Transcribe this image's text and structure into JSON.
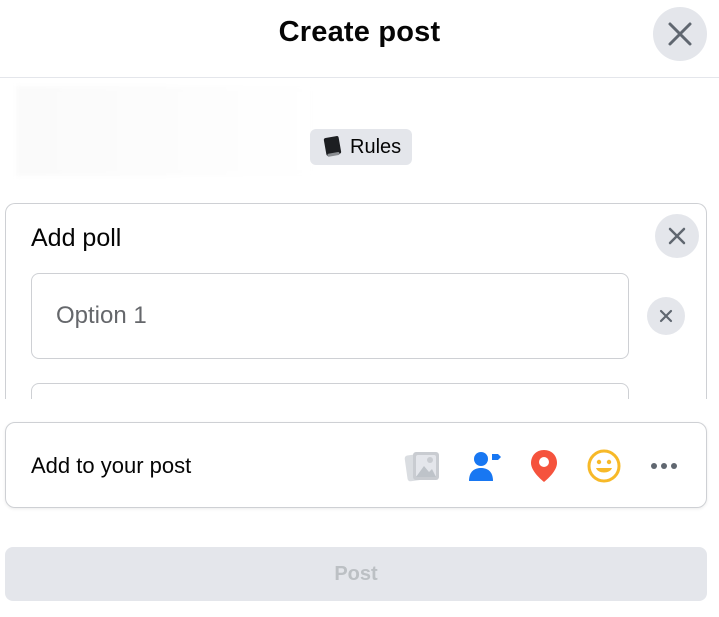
{
  "dialog": {
    "title": "Create post",
    "close_icon": "close-icon"
  },
  "rules": {
    "label": "Rules",
    "icon": "book-icon"
  },
  "poll": {
    "title": "Add poll",
    "options": [
      {
        "placeholder": "Option 1",
        "value": ""
      }
    ]
  },
  "add_to_post": {
    "label": "Add to your post",
    "icons": [
      "photo-icon",
      "tag-people-icon",
      "location-icon",
      "feeling-icon",
      "more-icon"
    ]
  },
  "post_button": {
    "label": "Post",
    "enabled": false
  },
  "colors": {
    "tag_blue": "#1877f2",
    "location_red": "#f5533d",
    "feeling_yellow": "#f7b928",
    "disabled_gray": "#e4e6eb"
  }
}
